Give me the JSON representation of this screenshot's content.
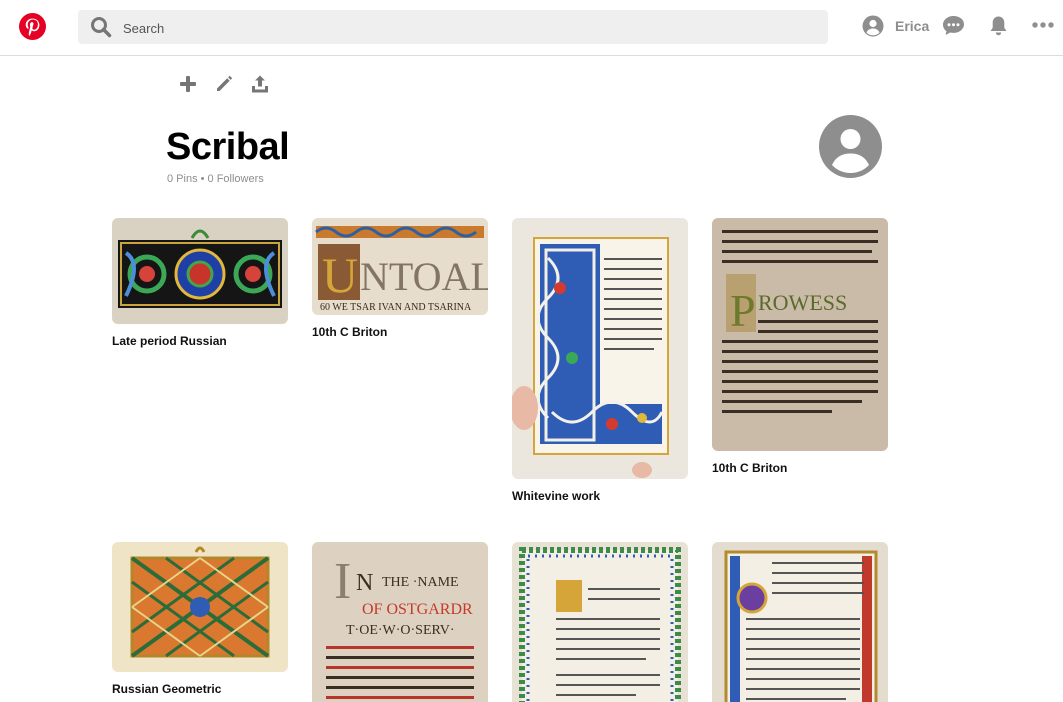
{
  "header": {
    "search_placeholder": "Search",
    "username": "Erica"
  },
  "board": {
    "title": "Scribal",
    "stats": "0 Pins • 0 Followers"
  },
  "pins": [
    {
      "caption": "Late period Russian"
    },
    {
      "caption": "10th C Briton"
    },
    {
      "caption": "Whitevine work"
    },
    {
      "caption": "10th C Briton"
    },
    {
      "caption": "Russian Geometric"
    },
    {
      "caption": ""
    },
    {
      "caption": ""
    },
    {
      "caption": ""
    }
  ],
  "colors": {
    "brand": "#e60023",
    "search_bg": "#efefef",
    "icon_gray": "#8e8e8e"
  }
}
